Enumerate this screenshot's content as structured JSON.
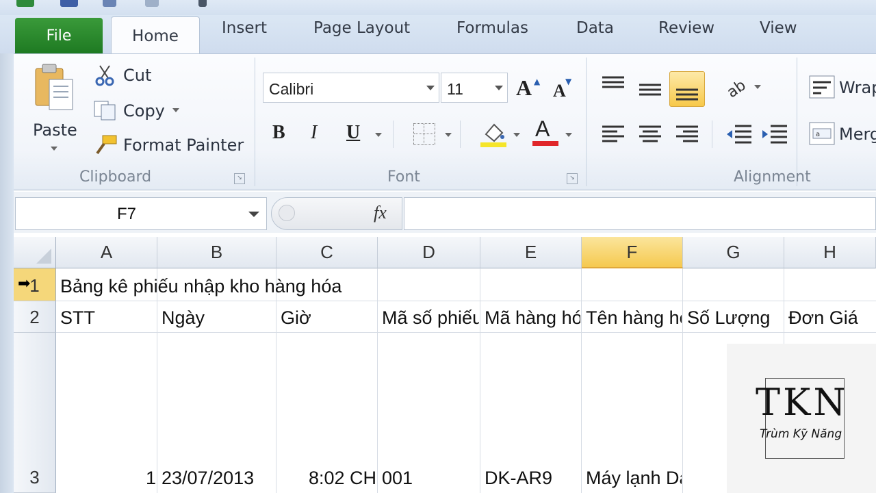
{
  "tabs": {
    "file": "File",
    "home": "Home",
    "insert": "Insert",
    "page_layout": "Page Layout",
    "formulas": "Formulas",
    "data": "Data",
    "review": "Review",
    "view": "View"
  },
  "clipboard": {
    "paste": "Paste",
    "cut": "Cut",
    "copy": "Copy",
    "format_painter": "Format Painter",
    "label": "Clipboard"
  },
  "font": {
    "name": "Calibri",
    "size": "11",
    "bold": "B",
    "italic": "I",
    "underline": "U",
    "font_color_glyph": "A",
    "grow_glyph": "A",
    "shrink_glyph": "A",
    "label": "Font",
    "fill_color": "#f5e52a",
    "text_color": "#e0262a"
  },
  "alignment": {
    "wrap": "Wrap",
    "merge": "Merg",
    "label": "Alignment"
  },
  "formula_bar": {
    "name_box": "F7",
    "fx": "fx",
    "value": ""
  },
  "columns": [
    "A",
    "B",
    "C",
    "D",
    "E",
    "F",
    "G",
    "H"
  ],
  "selected_column": "F",
  "rows": [
    {
      "num": "1",
      "cells": [
        "Bảng kê phiếu nhập kho hàng hóa"
      ]
    },
    {
      "num": "2",
      "cells": [
        "STT",
        "Ngày",
        "Giờ",
        "Mã số phiếu",
        "Mã hàng hóa",
        "Tên hàng hóa",
        "Số Lượng",
        "Đơn Giá"
      ]
    },
    {
      "num": "3",
      "cells": [
        "1",
        "23/07/2013",
        "8:02 CH",
        "001",
        "DK-AR9",
        "Máy lạnh Daikin",
        "",
        ""
      ]
    }
  ],
  "watermark": {
    "logo": "TKN",
    "subtitle": "Trùm Kỹ Năng"
  },
  "colors": {
    "file_tab": "#2a8a2e",
    "selection": "#f5c94f",
    "ribbon_bg": "#f2f5fa"
  }
}
